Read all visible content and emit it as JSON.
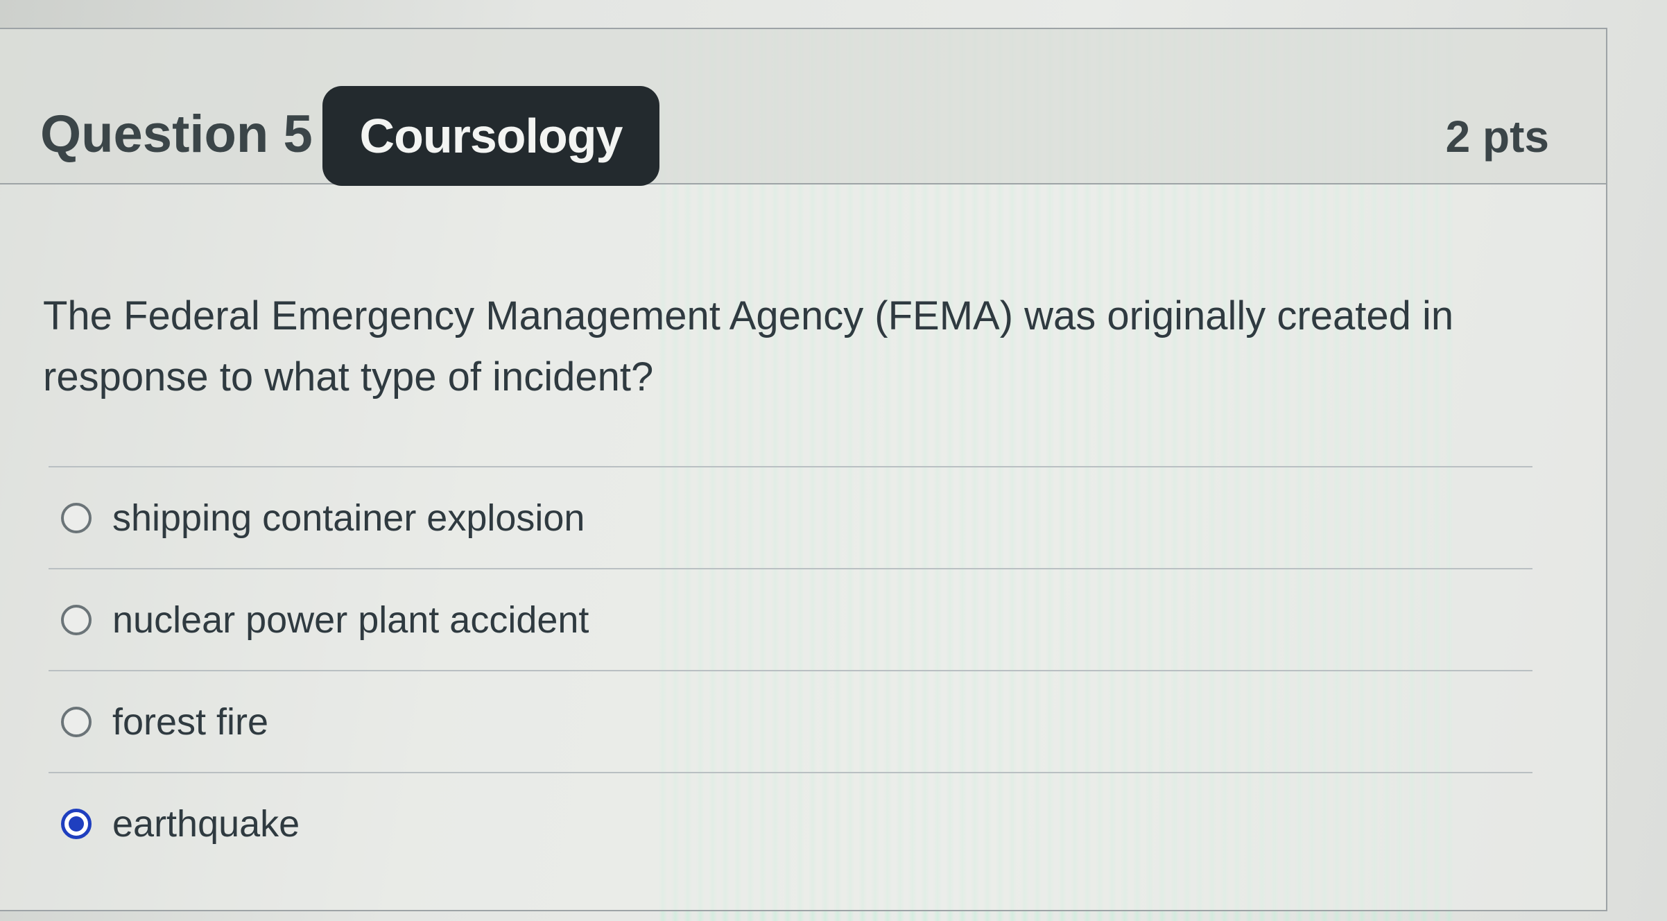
{
  "question": {
    "label": "Question 5",
    "points": "2 pts",
    "text": "The Federal Emergency Management Agency (FEMA) was originally created in response to what type of incident?"
  },
  "brand": {
    "name": "Coursology"
  },
  "answers": [
    {
      "label": "shipping container explosion",
      "selected": false
    },
    {
      "label": "nuclear power plant accident",
      "selected": false
    },
    {
      "label": "forest fire",
      "selected": false
    },
    {
      "label": "earthquake",
      "selected": true
    }
  ],
  "colors": {
    "selected_radio": "#1f3fbf",
    "badge_background": "#232a2e"
  }
}
